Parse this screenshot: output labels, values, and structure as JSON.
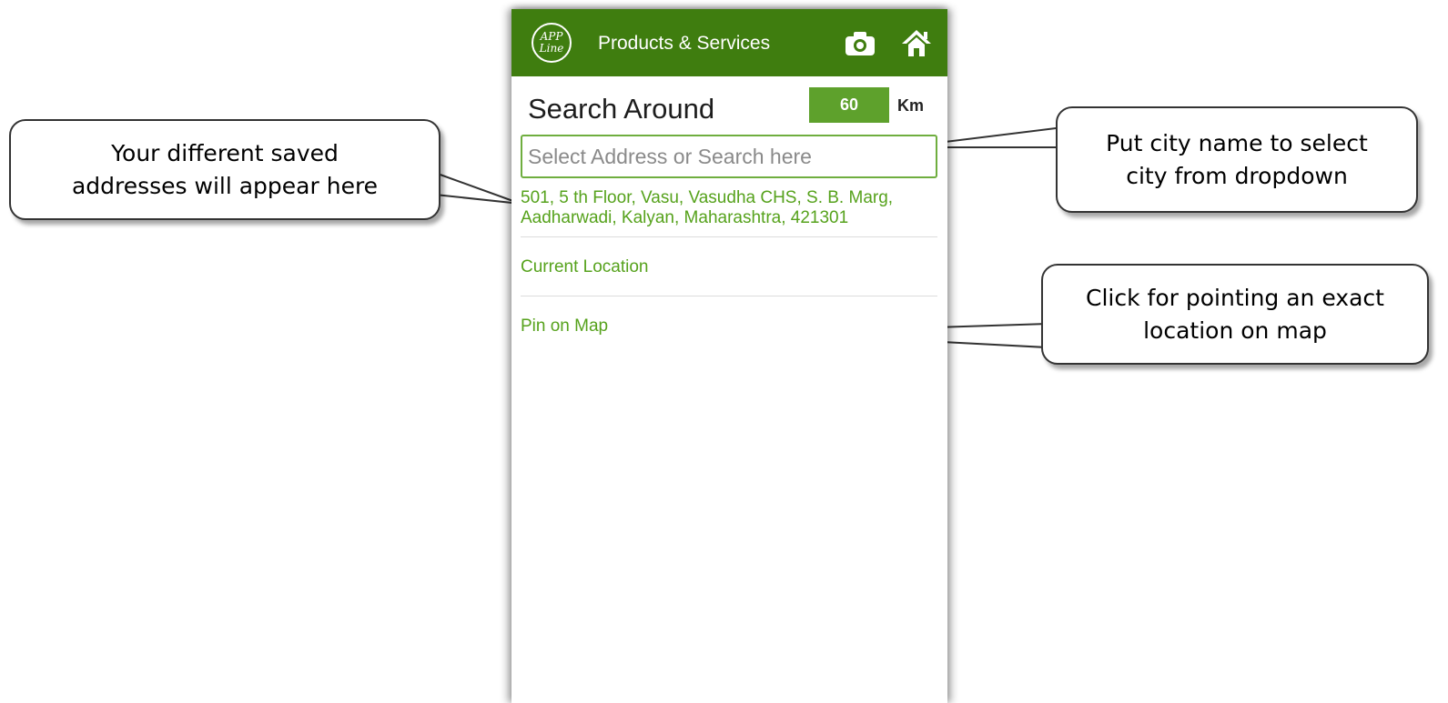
{
  "app_bar": {
    "logo_lines": [
      "APP",
      "Line"
    ],
    "title": "Products & Services",
    "camera_icon": "camera-icon",
    "home_icon": "home-icon",
    "color": "#3f7d0f"
  },
  "search": {
    "label": "Search Around",
    "radius_value": "60",
    "radius_unit": "Km",
    "placeholder": "Select Address or Search here"
  },
  "dropdown": {
    "saved_address": "501, 5 th Floor, Vasu, Vasudha CHS, S. B. Marg, Aadharwadi, Kalyan, Maharashtra, 421301",
    "current_location": "Current Location",
    "pin_on_map": "Pin on Map",
    "text_color": "#56a21c"
  },
  "callouts": {
    "saved_addresses": "Your different saved addresses will appear here",
    "city_search": "Put city name to select city from dropdown",
    "pin_map": "Click for pointing an exact location on map"
  }
}
